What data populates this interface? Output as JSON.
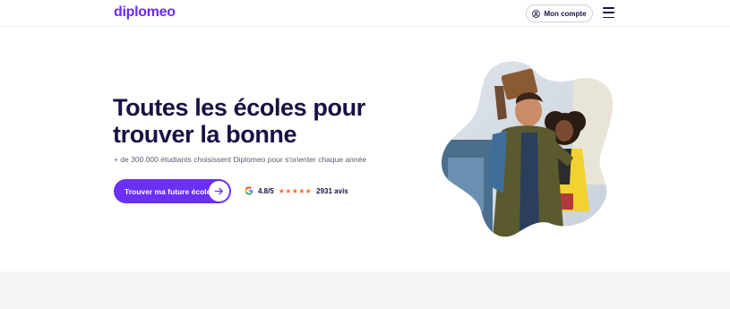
{
  "header": {
    "logo_text": "diplomeo",
    "account_label": "Mon compte"
  },
  "hero": {
    "title": "Toutes les écoles pour trouver la bonne",
    "subtitle": "+ de 300 000 étudiants choisissent Diplomeo pour s'orienter chaque année",
    "cta_label": "Trouver ma future école",
    "rating": {
      "score": "4.8/5",
      "stars": "★★★★★",
      "count": "2931 avis"
    }
  },
  "icons": {
    "account": "user-circle-icon",
    "menu": "hamburger-menu-icon",
    "cta": "arrow-right-icon",
    "rating": "google-icon"
  },
  "colors": {
    "brand": "#6b2ff5",
    "title": "#1b1043",
    "stars": "#ff6a2a"
  }
}
